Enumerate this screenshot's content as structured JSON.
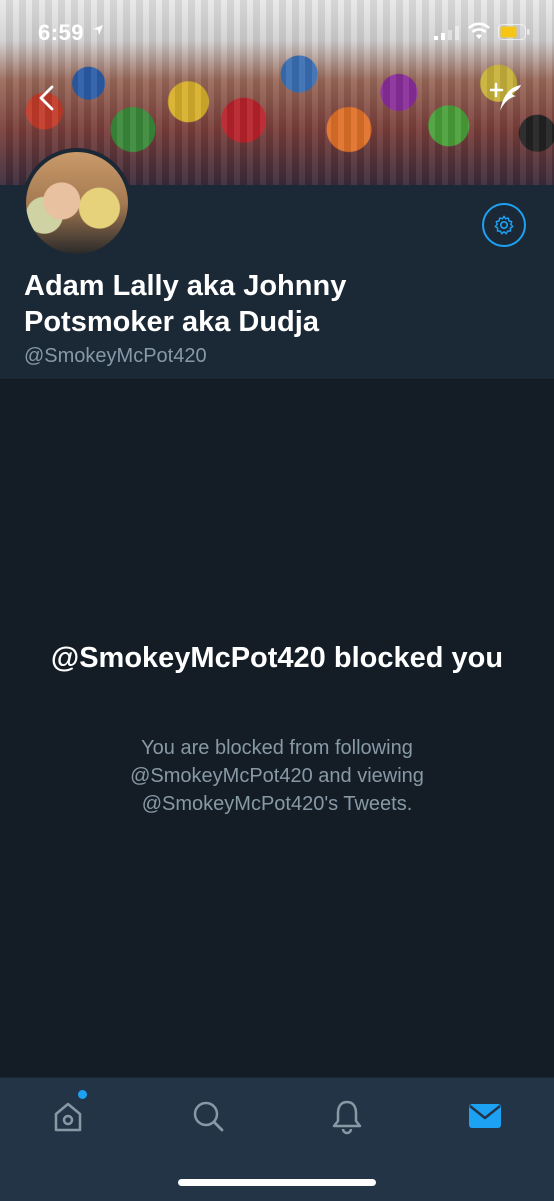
{
  "status_bar": {
    "time": "6:59"
  },
  "profile": {
    "display_name": "Adam Lally aka Johnny Potsmoker aka Dudja",
    "handle": "@SmokeyMcPot420"
  },
  "blocked": {
    "title": "@SmokeyMcPot420 blocked you",
    "message": "You are blocked from following @SmokeyMcPot420 and viewing @SmokeyMcPot420's Tweets."
  },
  "colors": {
    "accent": "#1da1f2",
    "background": "#141d26",
    "header_panel": "#1b2836",
    "tab_bar": "#243447",
    "secondary_text": "#8899a6"
  },
  "tab_bar": {
    "tabs": [
      {
        "icon": "home-icon",
        "active": false,
        "notification_dot": true
      },
      {
        "icon": "search-icon",
        "active": false
      },
      {
        "icon": "bell-icon",
        "active": false
      },
      {
        "icon": "mail-icon",
        "active": true
      }
    ]
  }
}
